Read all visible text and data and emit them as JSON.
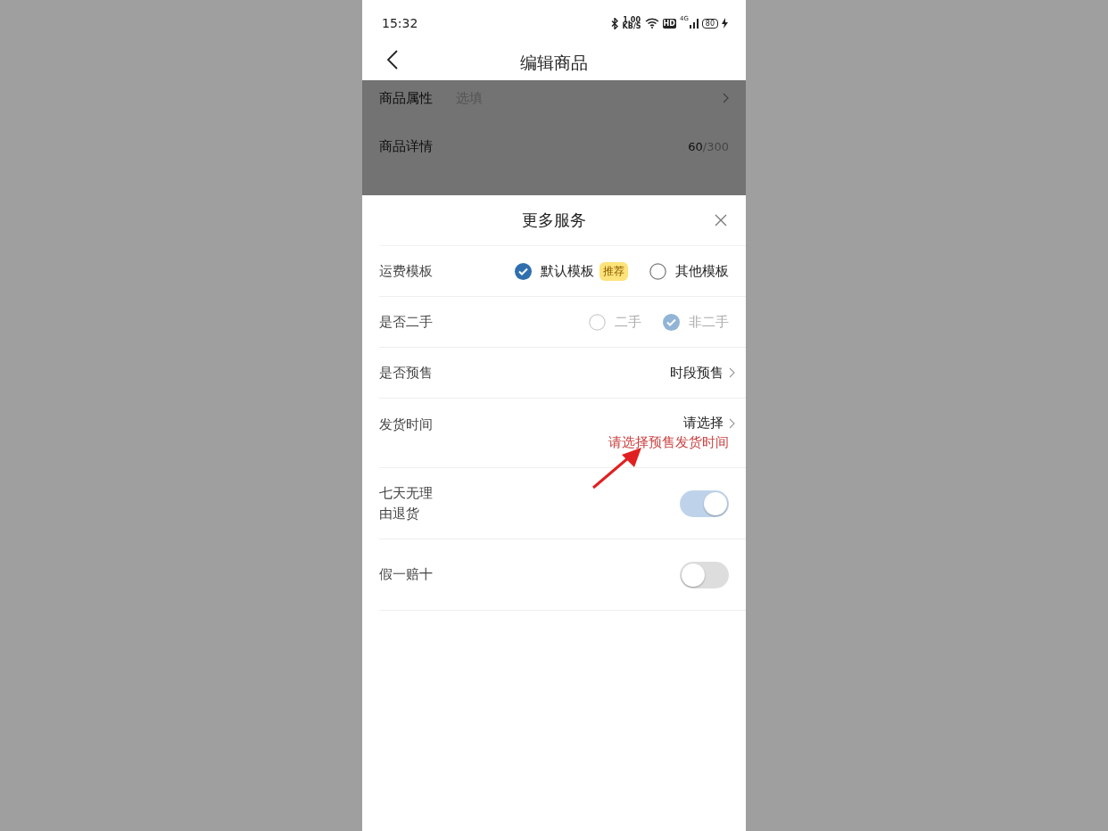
{
  "status_bar": {
    "time": "15:32",
    "speed": "1.00",
    "speed_unit": "KB/S",
    "hd": "HD",
    "network": "4G",
    "battery": "80"
  },
  "nav": {
    "title": "编辑商品"
  },
  "background_rows": [
    {
      "label": "商品属性",
      "value": "选填",
      "kind": "link"
    },
    {
      "label": "商品详情",
      "count": "60",
      "total": "/300",
      "kind": "count"
    }
  ],
  "sheet": {
    "title": "更多服务",
    "rows": [
      {
        "kind": "radio",
        "label": "运费模板",
        "disabled": false,
        "options": [
          {
            "label": "默认模板",
            "badge": "推荐",
            "selected": true
          },
          {
            "label": "其他模板",
            "selected": false
          }
        ]
      },
      {
        "kind": "radio",
        "label": "是否二手",
        "disabled": true,
        "options": [
          {
            "label": "二手",
            "selected": false
          },
          {
            "label": "非二手",
            "selected": true
          }
        ]
      },
      {
        "kind": "link",
        "label": "是否预售",
        "value": "时段预售"
      },
      {
        "kind": "link",
        "label": "发货时间",
        "value": "请选择",
        "error": "请选择预售发货时间"
      },
      {
        "kind": "switch",
        "label": "七天无理由退货",
        "on": true,
        "disabled": true
      },
      {
        "kind": "switch",
        "label": "假一赔十",
        "on": false,
        "disabled": false
      }
    ]
  }
}
